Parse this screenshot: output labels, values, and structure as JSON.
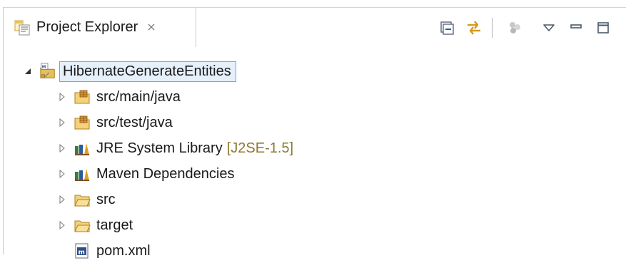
{
  "view": {
    "tab_title": "Project Explorer",
    "close_glyph": "⨯"
  },
  "toolbar": {
    "buttons": [
      {
        "name": "collapse-all",
        "icon": "collapse-all-icon"
      },
      {
        "name": "link-with-editor",
        "icon": "link-with-editor-icon"
      },
      {
        "name": "focus-active-task",
        "icon": "mylyn-focus-icon"
      },
      {
        "name": "view-menu",
        "icon": "view-menu-icon"
      },
      {
        "name": "minimize",
        "icon": "minimize-icon"
      },
      {
        "name": "maximize",
        "icon": "maximize-icon"
      }
    ]
  },
  "tree": {
    "root": {
      "label": "HibernateGenerateEntities",
      "icon": "maven-project-icon",
      "expanded": true,
      "selected": true
    },
    "children": [
      {
        "label": "src/main/java",
        "icon": "source-folder-icon",
        "decoration": "",
        "expandable": true
      },
      {
        "label": "src/test/java",
        "icon": "source-folder-icon",
        "decoration": "",
        "expandable": true
      },
      {
        "label": "JRE System Library",
        "icon": "library-icon",
        "decoration": "[J2SE-1.5]",
        "expandable": true
      },
      {
        "label": "Maven Dependencies",
        "icon": "library-icon",
        "decoration": "",
        "expandable": true
      },
      {
        "label": "src",
        "icon": "folder-icon",
        "decoration": "",
        "expandable": true
      },
      {
        "label": "target",
        "icon": "folder-icon",
        "decoration": "",
        "expandable": true
      },
      {
        "label": "pom.xml",
        "icon": "maven-pom-file-icon",
        "decoration": "",
        "expandable": false
      }
    ]
  },
  "colors": {
    "selection_bg": "#e5f0fb",
    "selection_border": "#7da2ce",
    "decoration_text": "#8a7a2e"
  }
}
